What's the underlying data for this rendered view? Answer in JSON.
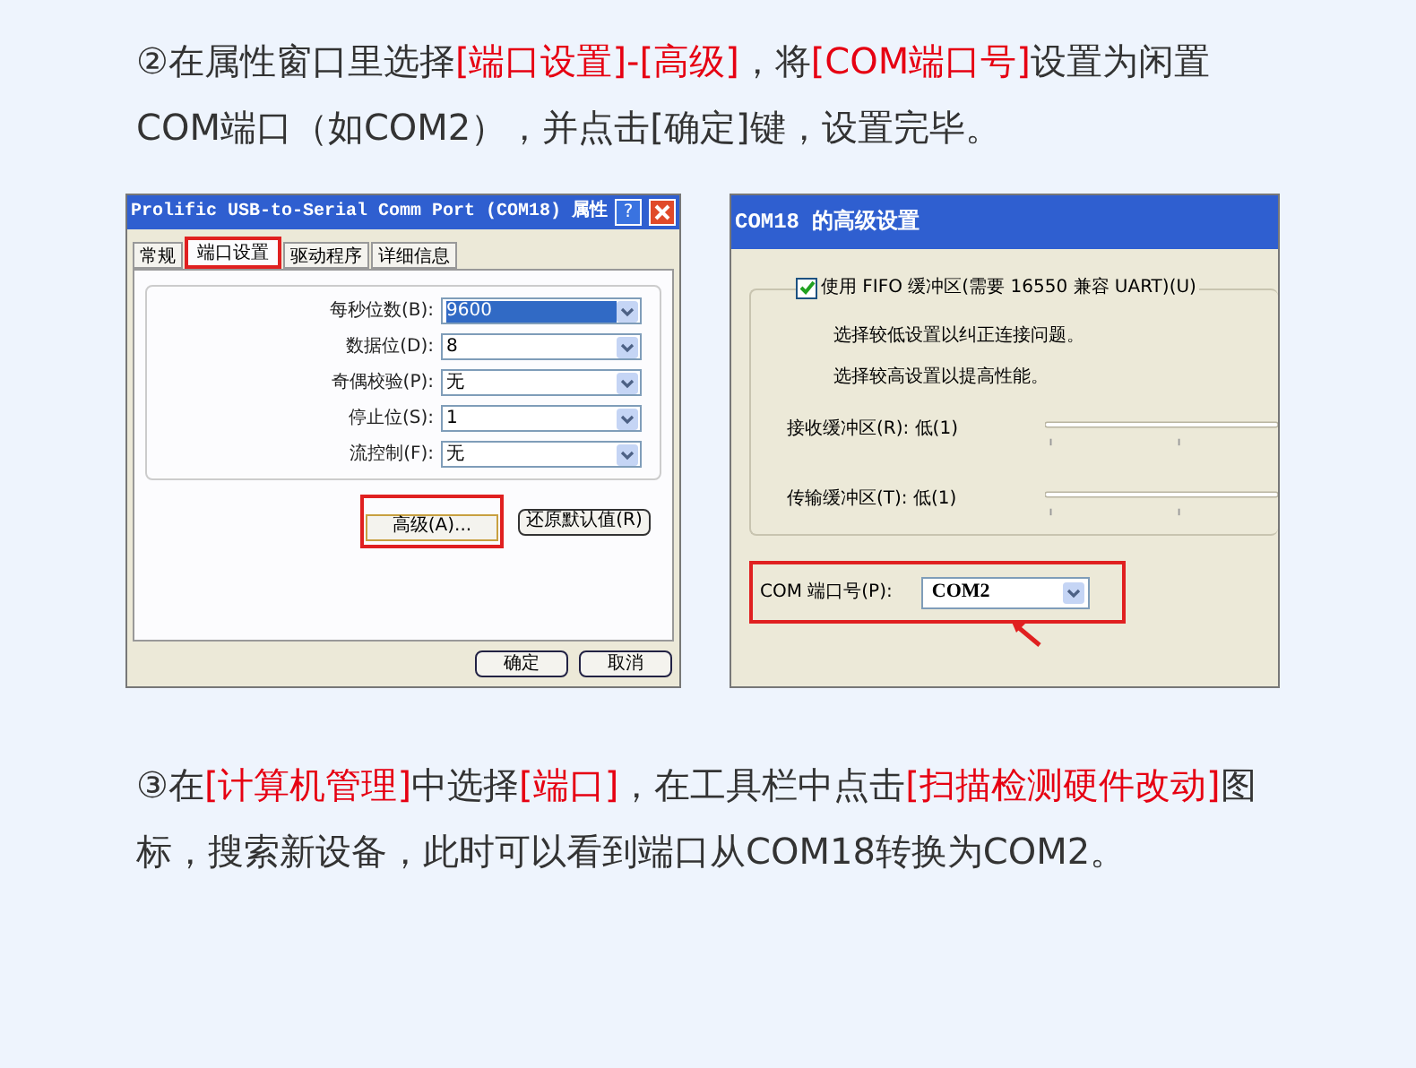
{
  "step_2": [
    {
      "text": "②在属性窗口里选择",
      "highlight": false
    },
    {
      "text": "[端口设置]-[高级]",
      "highlight": true
    },
    {
      "text": "，将",
      "highlight": false
    },
    {
      "text": "[COM端口号]",
      "highlight": true
    },
    {
      "text": "设置为闲置COM端口（如COM2），并点击[确定]键，设置完毕。",
      "highlight": false
    }
  ],
  "properties_dialog": {
    "title": "Prolific USB-to-Serial Comm Port (COM18) 属性",
    "help": "?",
    "tabs": [
      {
        "label": "常规",
        "selected": false
      },
      {
        "label": "端口设置",
        "selected": true
      },
      {
        "label": "驱动程序",
        "selected": false
      },
      {
        "label": "详细信息",
        "selected": false
      }
    ],
    "fields": [
      {
        "label": "每秒位数(B):",
        "value": "9600",
        "selected": true
      },
      {
        "label": "数据位(D):",
        "value": "8",
        "selected": false
      },
      {
        "label": "奇偶校验(P):",
        "value": "无",
        "selected": false
      },
      {
        "label": "停止位(S):",
        "value": "1",
        "selected": false
      },
      {
        "label": "流控制(F):",
        "value": "无",
        "selected": false
      }
    ],
    "advanced_button": "高级(A)...",
    "restore_button": "还原默认值(R)",
    "ok_button": "确定",
    "cancel_button": "取消"
  },
  "advanced_dialog": {
    "title": "COM18 的高级设置",
    "fifo": {
      "label": "使用 FIFO 缓冲区(需要 16550 兼容 UART)(U)",
      "checked": true
    },
    "hints": [
      "选择较低设置以纠正连接问题。",
      "选择较高设置以提高性能。"
    ],
    "buffers": [
      {
        "label": "接收缓冲区(R): 低(1)"
      },
      {
        "label": "传输缓冲区(T): 低(1)"
      }
    ],
    "port": {
      "label": "COM 端口号(P):",
      "value": "COM2"
    }
  },
  "step_3": [
    {
      "text": "③在",
      "highlight": false
    },
    {
      "text": "[计算机管理]",
      "highlight": true
    },
    {
      "text": "中选择",
      "highlight": false
    },
    {
      "text": "[端口]",
      "highlight": true
    },
    {
      "text": "，在工具栏中点击",
      "highlight": false
    },
    {
      "text": "[扫描检测硬件改动]",
      "highlight": true
    },
    {
      "text": "图标，搜索新设备，此时可以看到端口从COM18转换为COM2。",
      "highlight": false
    }
  ]
}
